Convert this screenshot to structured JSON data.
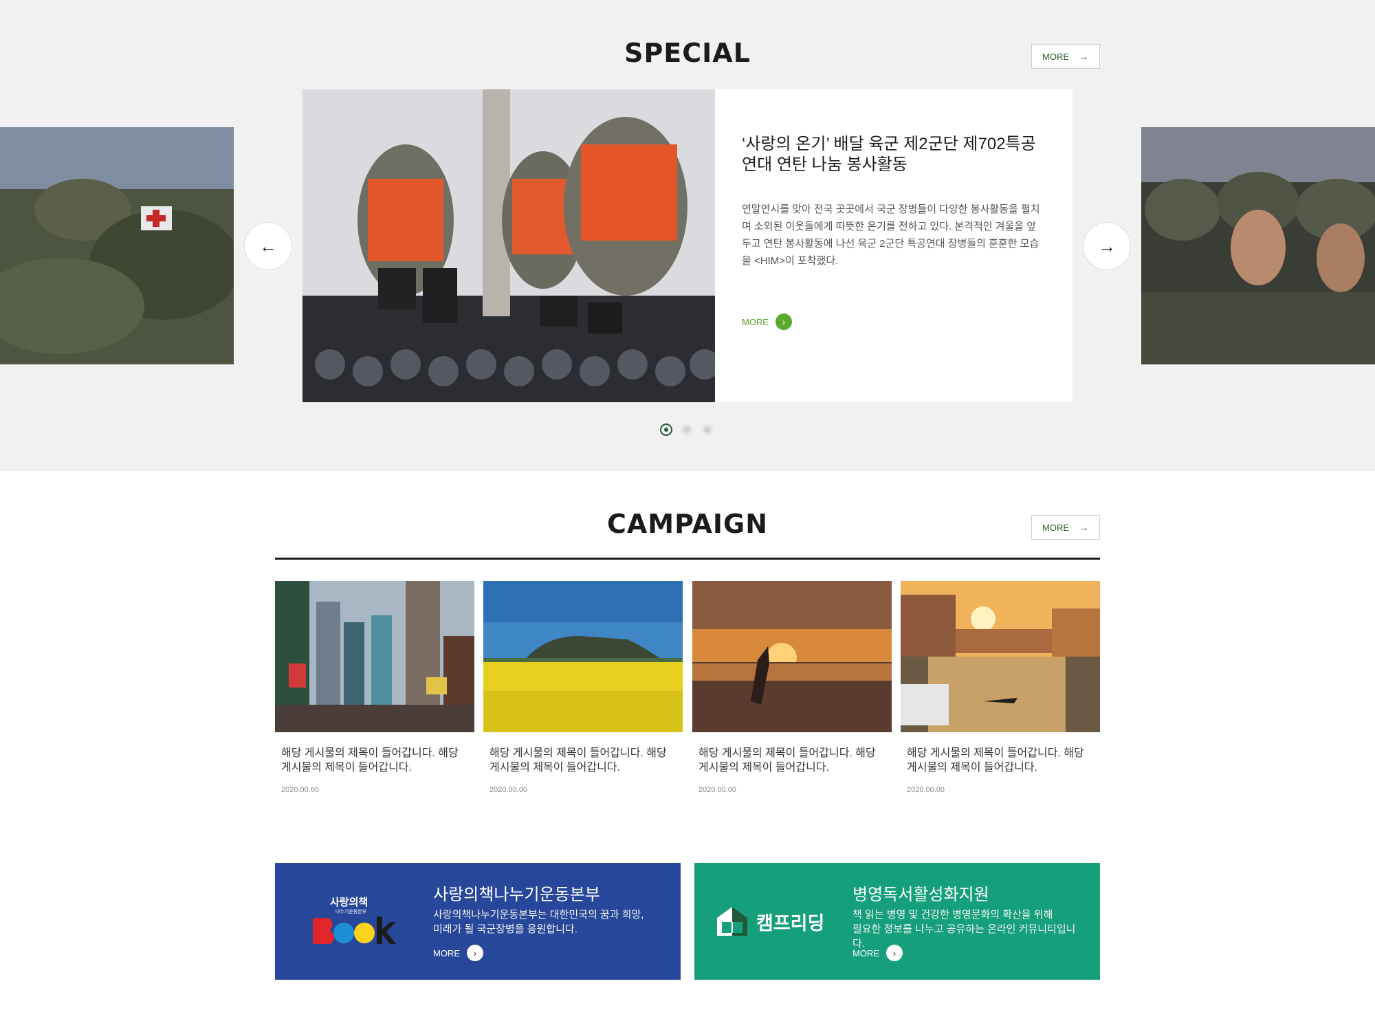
{
  "special": {
    "title": "SPECIAL",
    "more_label": "MORE",
    "card": {
      "title": "‘사랑의 온기’ 배달 육군 제2군단 제702특공연대 연탄 나눔 봉사활동",
      "description": "연말연시를 맞아 전국 곳곳에서 국군 장병들이 다양한 봉사활동을 펼치며 소외된 이웃들에게 따뜻한 온기를 전하고 있다. 본격적인 겨울을 앞두고 연탄 봉사활동에 나선 육군 2군단 특공연대 장병들의 훈훈한 모습을 <HIM>이 포착했다.",
      "more_label": "MORE"
    },
    "pager_count": 3,
    "active_page": 1
  },
  "campaign": {
    "title": "CAMPAIGN",
    "more_label": "MORE",
    "items": [
      {
        "text": "해당 게시물의 제목이 들어갑니다. 해당 게시물의 제목이 들어갑니다.",
        "date": "2020.00.00"
      },
      {
        "text": "해당 게시물의 제목이 들어갑니다. 해당 게시물의 제목이 들어갑니다.",
        "date": "2020.00.00"
      },
      {
        "text": "해당 게시물의 제목이 들어갑니다. 해당 게시물의 제목이 들어갑니다.",
        "date": "2020.00.00"
      },
      {
        "text": "해당 게시물의 제목이 들어갑니다. 해당 게시물의 제목이 들어갑니다.",
        "date": "2020.00.00"
      }
    ]
  },
  "banners": [
    {
      "title": "사랑의책나누기운동본부",
      "desc_line1": "사랑의책나누기운동본부는 대한민국의 꿈과 희망,",
      "desc_line2": "미래가 될 국군장병을 응원합니다.",
      "more_label": "MORE",
      "logo_small": "사랑의책",
      "logo_sub": "나누기운동본부",
      "logo_word": "book",
      "color": "#27489a"
    },
    {
      "title": "병영독서활성화지원",
      "desc_line1": "책 읽는 병영 및 건강한 병영문화의 확산을 위해",
      "desc_line2": "필요한 정보를 나누고 공유하는 온라인 커뮤니티입니다.",
      "more_label": "MORE",
      "logo_text": "캠프리딩",
      "color": "#15a07b"
    }
  ],
  "icons": {
    "arrow_left": "←",
    "arrow_right": "→",
    "chevron_right": "›"
  }
}
